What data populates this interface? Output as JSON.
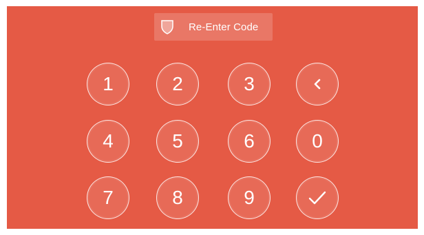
{
  "header": {
    "title": "Re-Enter Code",
    "icon": "shield-icon"
  },
  "keypad": {
    "keys": [
      {
        "label": "1"
      },
      {
        "label": "2"
      },
      {
        "label": "3"
      },
      {
        "icon": "back-chevron-icon"
      },
      {
        "label": "4"
      },
      {
        "label": "5"
      },
      {
        "label": "6"
      },
      {
        "label": "0"
      },
      {
        "label": "7"
      },
      {
        "label": "8"
      },
      {
        "label": "9"
      },
      {
        "icon": "checkmark-icon"
      }
    ]
  },
  "colors": {
    "background": "#e55a45",
    "text": "#ffffff"
  }
}
